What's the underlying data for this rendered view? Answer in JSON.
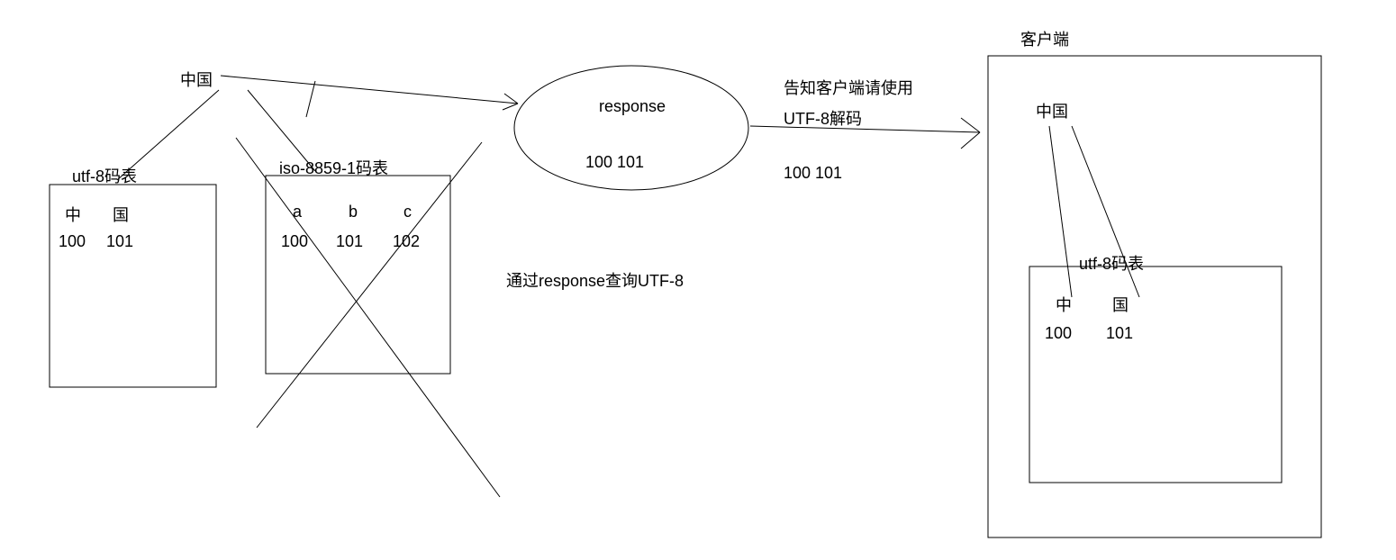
{
  "top_label": "中国",
  "utf8_left": {
    "title": "utf-8码表",
    "row1_a": "中",
    "row1_b": "国",
    "row2_a": "100",
    "row2_b": "101"
  },
  "iso": {
    "title": "iso-8859-1码表",
    "h1": "a",
    "h2": "b",
    "h3": "c",
    "v1": "100",
    "v2": "101",
    "v3": "102"
  },
  "response": {
    "title": "response",
    "values": "100 101"
  },
  "middle_note": "通过response查询UTF-8",
  "notice": {
    "line1": "告知客户端请使用",
    "line2": "UTF-8解码",
    "values": "100 101"
  },
  "client": {
    "title": "客户端",
    "text": "中国",
    "utf8_title": "utf-8码表",
    "row1_a": "中",
    "row1_b": "国",
    "row2_a": "100",
    "row2_b": "101"
  }
}
